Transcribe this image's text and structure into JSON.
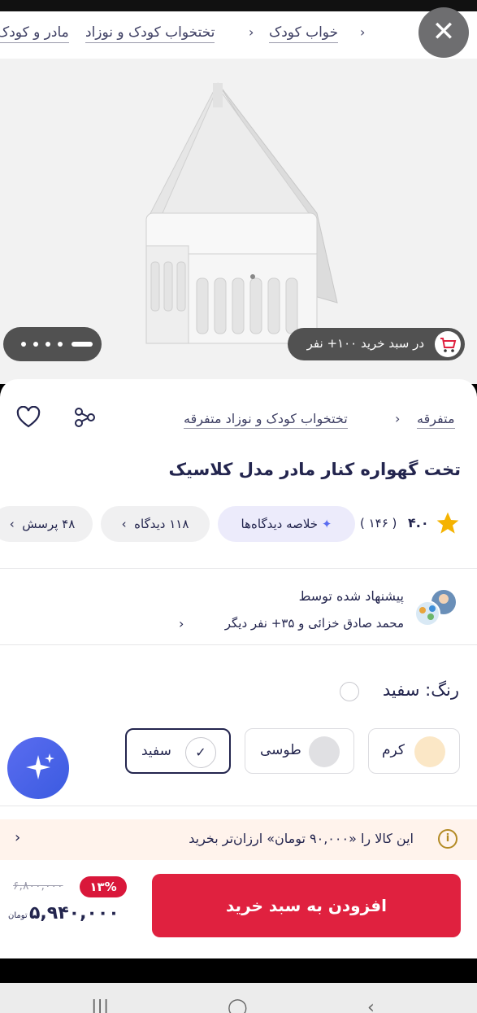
{
  "breadcrumb": {
    "items": [
      "مادر و کودک",
      "خواب کودک",
      "تختخواب کودک و نوزاد"
    ],
    "separator": "›"
  },
  "close_icon": "close-icon",
  "gallery": {
    "cart_badge": "در سبد خرید ۱۰۰+ نفر",
    "active_slide_index": 0,
    "slide_count": 5
  },
  "category_path": {
    "items": [
      "متفرقه",
      "تختخواب کودک و نوزاد متفرقه"
    ],
    "separator": "›"
  },
  "product": {
    "title": "تخت گهواره کنار مادر مدل کلاسیک"
  },
  "rating": {
    "score": "۴.۰",
    "count": "( ۱۴۶ )"
  },
  "chips": {
    "summary": "خلاصه دیدگاه‌ها",
    "reviews": "۱۱۸ دیدگاه",
    "questions": "۴۸ پرسش"
  },
  "recommended": {
    "title": "پیشنهاد شده توسط",
    "by": "محمد صادق خزائی و ۳۵+ نفر دیگر"
  },
  "color": {
    "label": "رنگ: سفید",
    "options": [
      {
        "name": "کرم",
        "hex": "#fbe7c6"
      },
      {
        "name": "طوسی",
        "hex": "#e0e0e3"
      },
      {
        "name": "سفید",
        "hex": "#ffffff",
        "selected": true
      }
    ]
  },
  "promo": {
    "text": "این کالا را «۹۰,۰۰۰ تومان» ارزان‌تر بخرید"
  },
  "purchase": {
    "button": "افزودن به سبد خرید",
    "old_price": "۶,۸۰۰,۰۰۰",
    "discount": "۱۳%",
    "price": "۵,۹۴۰,۰۰۰",
    "currency": "تومان"
  },
  "colors": {
    "brand_red": "#e0213f",
    "discount_red": "#d9173a",
    "fab_blue": "#4a63ea",
    "promo_bg": "#fff3ec"
  }
}
